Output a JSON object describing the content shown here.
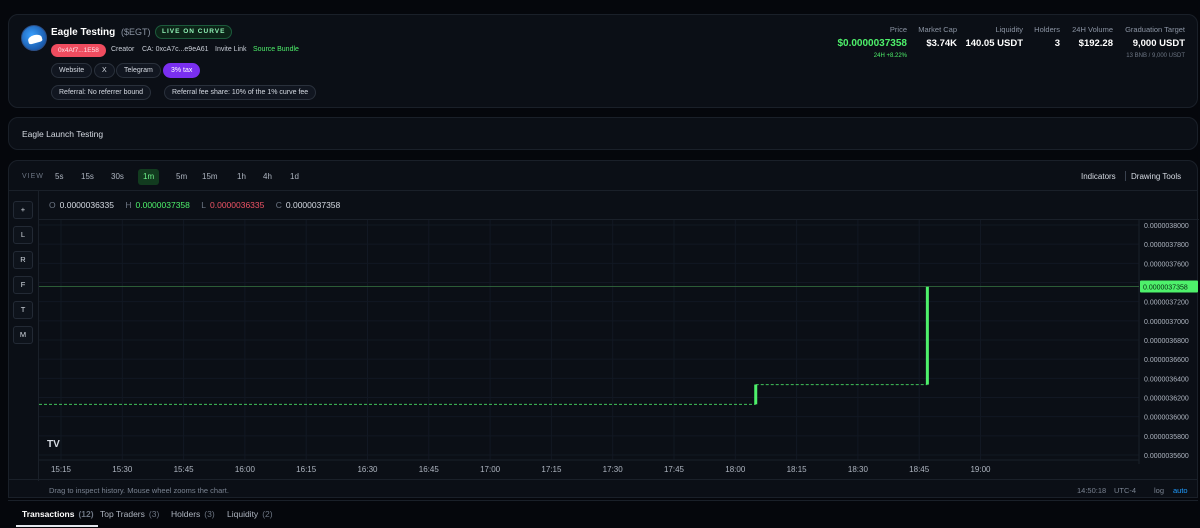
{
  "token": {
    "name": "Eagle Testing",
    "symbol": "($EGT)",
    "status": "LIVE ON CURVE",
    "address_short": "0x4Af7...1E58",
    "creator_label": "Creator",
    "ca_text": "CA: 0xcA7c...e9eA61",
    "invite_link": "Invite Link",
    "source_bundle": "Source Bundle",
    "links": [
      "Website",
      "X",
      "Telegram"
    ],
    "tax": "3% tax",
    "referral": "Referral: No referrer bound",
    "referral_fee": "Referral fee share: 10% of the 1% curve fee"
  },
  "stats": {
    "price": {
      "label": "Price",
      "value": "$0.0000037358",
      "change": "24H +8.22%"
    },
    "market_cap": {
      "label": "Market Cap",
      "value": "$3.74K"
    },
    "liquidity": {
      "label": "Liquidity",
      "value": "140.05 USDT"
    },
    "holders": {
      "label": "Holders",
      "value": "3"
    },
    "volume": {
      "label": "24H Volume",
      "value": "$192.28"
    },
    "graduation": {
      "label": "Graduation Target",
      "value": "9,000 USDT",
      "sub": "13 BNB / 9,000 USDT"
    }
  },
  "description": "Eagle Launch Testing",
  "chart_toolbar": {
    "view_label": "VIEW",
    "timeframes": [
      "5s",
      "15s",
      "30s",
      "1m",
      "5m",
      "15m",
      "1h",
      "4h",
      "1d"
    ],
    "active_timeframe": "1m",
    "indicators": "Indicators",
    "drawing_tools": "Drawing Tools"
  },
  "side_tools": [
    "+",
    "L",
    "R",
    "F",
    "T",
    "M"
  ],
  "ohlc": {
    "o_label": "O",
    "o": "0.0000036335",
    "h_label": "H",
    "h": "0.0000037358",
    "l_label": "L",
    "l": "0.0000036335",
    "c_label": "C",
    "c": "0.0000037358"
  },
  "chart_footer": {
    "hint": "Drag to inspect history. Mouse wheel zooms the chart.",
    "time": "14:50:18",
    "timezone": "UTC-4",
    "log": "log",
    "auto": "auto"
  },
  "chart_data": {
    "type": "line",
    "x_ticks": [
      "15:15",
      "15:30",
      "15:45",
      "16:00",
      "16:15",
      "16:30",
      "16:45",
      "17:00",
      "17:15",
      "17:30",
      "17:45",
      "18:00",
      "18:15",
      "18:30",
      "18:45",
      "19:00"
    ],
    "y_ticks": [
      "0.0000038000",
      "0.0000037800",
      "0.0000037600",
      "0.0000037400",
      "0.0000037200",
      "0.0000037000",
      "0.0000036800",
      "0.0000036600",
      "0.0000036400",
      "0.0000036200",
      "0.0000036000",
      "0.0000035800",
      "0.0000035600"
    ],
    "ylim": [
      3.5548e-06,
      3.8052e-06
    ],
    "price_label": "0.0000037358",
    "baseline_start": 3.6129e-06,
    "candles": [
      {
        "time": "18:05",
        "open": 3.6129e-06,
        "close": 3.6335e-06
      },
      {
        "time": "18:47",
        "open": 3.6335e-06,
        "close": 3.7358e-06
      }
    ],
    "current_price": 3.7358e-06,
    "up_color": "#4ef16b"
  },
  "tabs": [
    {
      "label": "Transactions",
      "count": "(12)"
    },
    {
      "label": "Top Traders",
      "count": "(3)"
    },
    {
      "label": "Holders",
      "count": "(3)"
    },
    {
      "label": "Liquidity",
      "count": "(2)"
    }
  ]
}
